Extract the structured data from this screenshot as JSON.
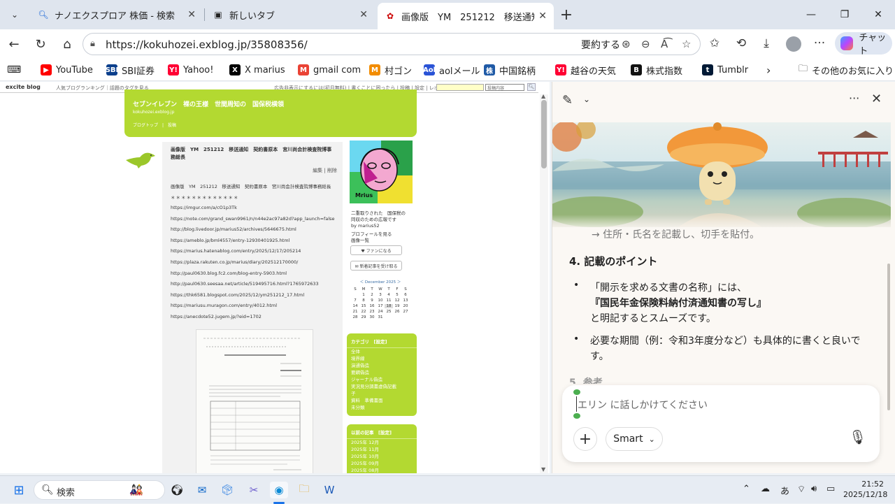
{
  "tabs": [
    {
      "title": "ナノエクスプロア 株価 - 検索",
      "icon": "search-icon"
    },
    {
      "title": "新しいタブ",
      "icon": "newtab-icon"
    },
    {
      "title": "画像版　YM　251212　移送通知",
      "icon": "blog-favicon"
    }
  ],
  "address": {
    "url": "https://kokuhozei.exblog.jp/35808356/",
    "summarize_label": "要約する"
  },
  "toolbar": {
    "chat_label": "チャット"
  },
  "bookmarks": [
    {
      "label": "YouTube",
      "icon": "youtube-icon",
      "color": "#ff0000",
      "glyph": "▶"
    },
    {
      "label": "SBI証券",
      "icon": "sbi-icon",
      "color": "#0b3f8c",
      "glyph": "SBI"
    },
    {
      "label": "Yahoo!",
      "icon": "yahoo-icon",
      "color": "#ff0033",
      "glyph": "Y!"
    },
    {
      "label": "X marius",
      "icon": "x-icon",
      "color": "#000000",
      "glyph": "X"
    },
    {
      "label": "gmail com",
      "icon": "gmail-icon",
      "color": "#ea4335",
      "glyph": "M"
    },
    {
      "label": "村ゴン",
      "icon": "murakami-icon",
      "color": "#f28c00",
      "glyph": "M"
    },
    {
      "label": "aolメール",
      "icon": "aol-icon",
      "color": "#2a53d6",
      "glyph": "Aol"
    },
    {
      "label": "中国銘柄",
      "icon": "kabutan-icon",
      "color": "#1f5aa6",
      "glyph": "株"
    },
    {
      "label": "越谷の天気",
      "icon": "yahoo-weather-icon",
      "color": "#ff0033",
      "glyph": "Y!"
    },
    {
      "label": "株式指数",
      "icon": "b-icon",
      "color": "#111111",
      "glyph": "B"
    },
    {
      "label": "Tumblr",
      "icon": "tumblr-icon",
      "color": "#001935",
      "glyph": "t"
    }
  ],
  "bookmarks_other": "その他のお気に入り",
  "blog": {
    "header_logo": "excite blog",
    "header_links": "人気ブログランキング｜話題のタグを見る",
    "header_right": "広告非表示にするには(初月無料) | 書くことに困ったら | 投稿 | 設定 | レポート",
    "search_select": "投稿内容",
    "title": "セブンイレブン　裸の王様　世間周知の　国保税横領",
    "subtitle": "kokuhozei.exblog.jp",
    "nav": "ブログトップ　|　投稿",
    "post_title": "画像版　YM　251212　移送通知　契約書原本　宮川尚会計検査院博事務総長",
    "post_edit": "編集 | 削除",
    "post_heading": "画像版　YM　251212　移送通知　契約書原本　宮川尚会計検査院博事務総長",
    "stars": "＊＊＊＊＊＊＊＊＊＊＊＊＊",
    "links": [
      "https://imgur.com/a/cO1p3Tk",
      "https://note.com/grand_swan9961/n/n44e2ac97a82d?app_launch=false",
      "http://blog.livedoor.jp/marius52/archives/5646675.html",
      "https://ameblo.jp/bml4557/entry-12930401925.html",
      "https://marius.hatenablog.com/entry/2025/12/17/205214",
      "https://plaza.rakuten.co.jp/marius/diary/202512170000/",
      "http://paul0630.blog.fc2.com/blog-entry-5903.html",
      "http://paul0630.seesaa.net/article/519495716.html?1765972633",
      "https://thk6581.blogspot.com/2025/12/ym251212_17.html",
      "https://mariusu.muragon.com/entry/4012.html",
      "https://anecdote52.jugem.jp/?eid=1702"
    ],
    "doc_title": "開示請求に係る事案の移送について（通知）",
    "profile_caption": "Mrius",
    "profile_text": [
      "二重取りされた　国保税の",
      "同収のための広報です",
      "by marius52",
      "プロフィールを見る",
      "画像一覧"
    ],
    "fan_button": "♥ ファンになる",
    "notify_button": "✉ 新着記事を受け取る",
    "calendar_title": "＜ December 2025 ＞",
    "calendar_days": [
      "S",
      "M",
      "T",
      "W",
      "T",
      "F",
      "S"
    ],
    "calendar_cells": [
      "",
      "1",
      "2",
      "3",
      "4",
      "5",
      "6",
      "7",
      "8",
      "9",
      "10",
      "11",
      "12",
      "13",
      "14",
      "15",
      "16",
      "17",
      "18",
      "19",
      "20",
      "21",
      "22",
      "23",
      "24",
      "25",
      "26",
      "27",
      "28",
      "29",
      "30",
      "31",
      "",
      "",
      ""
    ],
    "category_title": "カテゴリ　[設定]",
    "categories": [
      "全体",
      "境界線",
      "演通偽造",
      "要綱偽造",
      "ジャーナル偽造",
      "実況見分調書虚偽記載",
      "子",
      "資料　準備書面",
      "未分類"
    ],
    "archive_title": "以前の記事　[設定]",
    "archives": [
      "2025年 12月",
      "2025年 11月",
      "2025年 10月",
      "2025年 09月",
      "2025年 08月"
    ]
  },
  "copilot": {
    "partial_top": "→ 住所・氏名を記載し、切手を貼付。",
    "section_title": "4. 記載のポイント",
    "bullet1_a": "「開示を求める文書の名称」には、",
    "bullet1_b": "『国民年金保険料納付済通知書の写し』",
    "bullet1_c": "と明記するとスムーズです。",
    "bullet2": "必要な期間（例：令和3年度分など）も具体的に書くと良いです。",
    "partial_bottom": "5. 参考",
    "input_placeholder": "エリン に話しかけてください",
    "mode_label": "Smart"
  },
  "taskbar": {
    "search_placeholder": "検索",
    "time": "21:52",
    "date": "2025/12/18",
    "ime": "あ"
  }
}
